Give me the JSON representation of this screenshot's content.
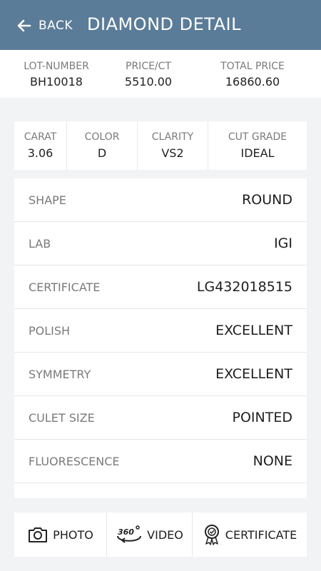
{
  "header": {
    "back_label": "BACK",
    "title": "DIAMOND DETAIL",
    "color": "#5b7c98"
  },
  "summary": [
    {
      "label": "LOT-NUMBER",
      "value": "BH10018"
    },
    {
      "label": "PRICE/CT",
      "value": "5510.00"
    },
    {
      "label": "TOTAL PRICE",
      "value": "16860.60"
    }
  ],
  "specs": [
    {
      "label": "CARAT",
      "value": "3.06"
    },
    {
      "label": "COLOR",
      "value": "D"
    },
    {
      "label": "CLARITY",
      "value": "VS2"
    },
    {
      "label": "CUT GRADE",
      "value": "IDEAL"
    }
  ],
  "details": [
    {
      "key": "SHAPE",
      "value": "ROUND"
    },
    {
      "key": "LAB",
      "value": "IGI"
    },
    {
      "key": "CERTIFICATE",
      "value": "LG432018515"
    },
    {
      "key": "POLISH",
      "value": "EXCELLENT"
    },
    {
      "key": "SYMMETRY",
      "value": "EXCELLENT"
    },
    {
      "key": "CULET SIZE",
      "value": "POINTED"
    },
    {
      "key": "FLUORESCENCE",
      "value": "NONE"
    },
    {
      "key": "",
      "value": ""
    }
  ],
  "actions": [
    {
      "label": "PHOTO",
      "icon": "camera-icon"
    },
    {
      "label": "VIDEO",
      "icon": "360-video-icon"
    },
    {
      "label": "CERTIFICATE",
      "icon": "certificate-badge-icon"
    }
  ]
}
